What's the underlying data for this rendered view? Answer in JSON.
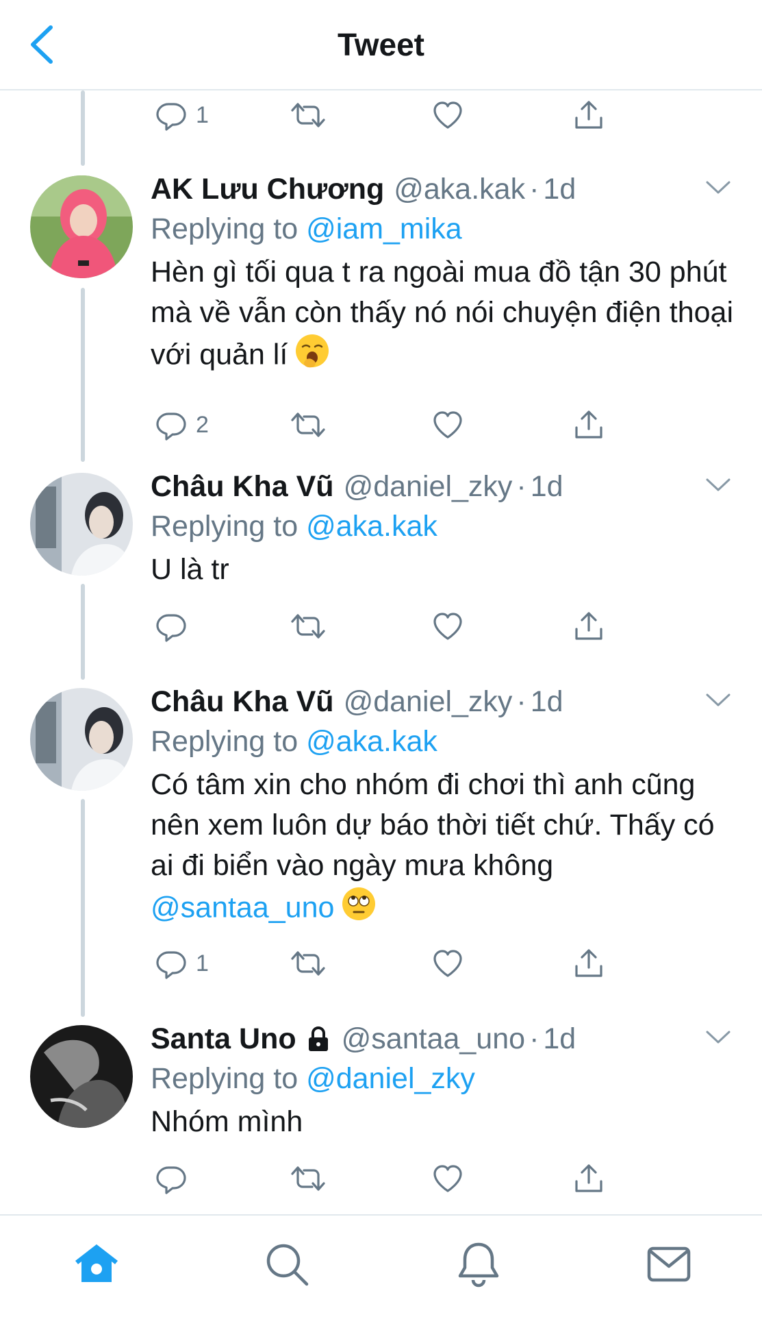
{
  "header": {
    "title": "Tweet",
    "back_icon": "chevron-left-icon"
  },
  "colors": {
    "accent": "#1da1f2",
    "muted": "#657786",
    "text": "#14171a",
    "divider": "#e1e8ed"
  },
  "top_actions": {
    "reply_count": "1"
  },
  "tweets": [
    {
      "name": "AK Lưu Chương",
      "handle": "@aka.kak",
      "time": "1d",
      "replying_prefix": "Replying to ",
      "replying_to": "@iam_mika",
      "text": "Hèn gì tối qua t ra ngoài mua đồ tận 30 phút mà về vẫn còn thấy nó nói chuyện điện thoại với quản lí",
      "emoji": "yawning-face",
      "reply_count": "2"
    },
    {
      "name": "Châu Kha Vũ",
      "handle": "@daniel_zky",
      "time": "1d",
      "replying_prefix": "Replying to ",
      "replying_to": "@aka.kak",
      "text": "U là tr",
      "reply_count": ""
    },
    {
      "name": "Châu Kha Vũ",
      "handle": "@daniel_zky",
      "time": "1d",
      "replying_prefix": "Replying to ",
      "replying_to": "@aka.kak",
      "text": "Có tâm xin cho nhóm đi chơi thì anh cũng nên xem luôn dự báo thời tiết chứ. Thấy có ai đi biển vào ngày mưa không",
      "mention": "@santaa_uno",
      "emoji": "face-with-rolling-eyes",
      "reply_count": "1"
    },
    {
      "name": "Santa Uno",
      "handle": "@santaa_uno",
      "time": "1d",
      "protected": true,
      "replying_prefix": "Replying to ",
      "replying_to": "@daniel_zky",
      "text": "Nhóm mình",
      "reply_count": ""
    }
  ],
  "tabbar": [
    "home-icon",
    "search-icon",
    "notifications-icon",
    "messages-icon"
  ]
}
